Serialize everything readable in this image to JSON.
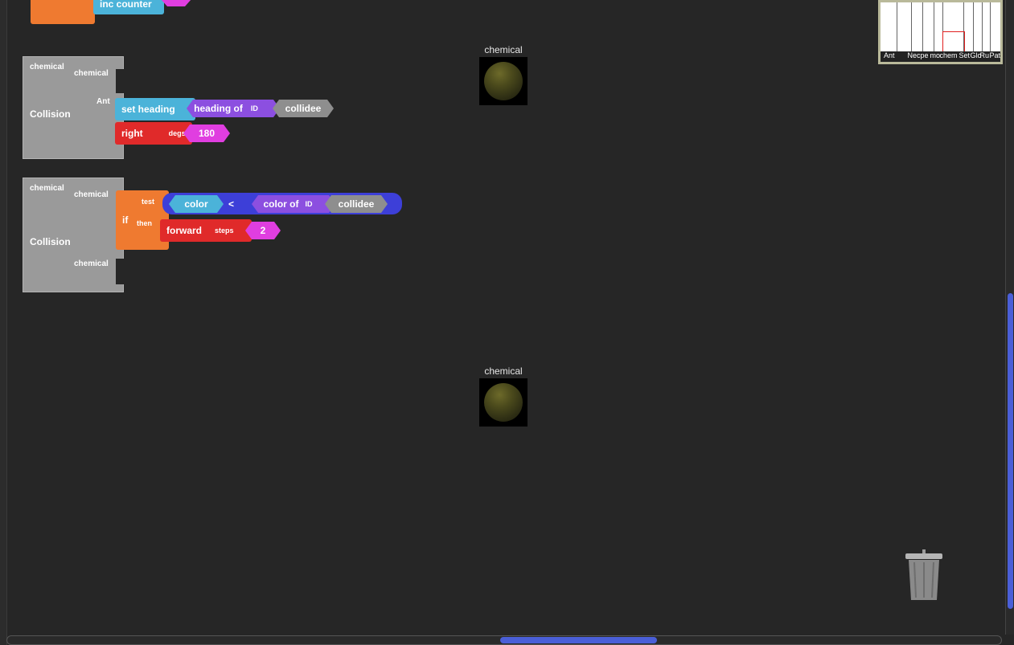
{
  "top_block": {
    "label": "inc counter"
  },
  "collision1": {
    "title": "Collision",
    "arg1": "chemical",
    "arg2": "chemical",
    "arg3": "Ant",
    "set_heading": "set heading",
    "heading_of": "heading of",
    "id": "ID",
    "collidee": "collidee",
    "right": "right",
    "degs": "degs",
    "degs_value": "180"
  },
  "collision2": {
    "title": "Collision",
    "arg1": "chemical",
    "arg2": "chemical",
    "arg3": "chemical",
    "if": "if",
    "test": "test",
    "then": "then",
    "color": "color",
    "op": "<",
    "color_of": "color of",
    "id": "ID",
    "collidee": "collidee",
    "forward": "forward",
    "steps": "steps",
    "steps_value": "2"
  },
  "agents": [
    {
      "label": "chemical"
    },
    {
      "label": "chemical"
    }
  ],
  "minimap": {
    "labels": [
      "Ant",
      "Nec",
      "pe",
      "mo",
      "chem",
      "Set",
      "Glo",
      "Ru",
      "Pat"
    ]
  },
  "icons": {
    "trash": "trash-can-icon"
  },
  "colors": {
    "background": "#262626",
    "scroll_thumb": "#4a5fd8",
    "collision_block": "#9a9a9a"
  }
}
